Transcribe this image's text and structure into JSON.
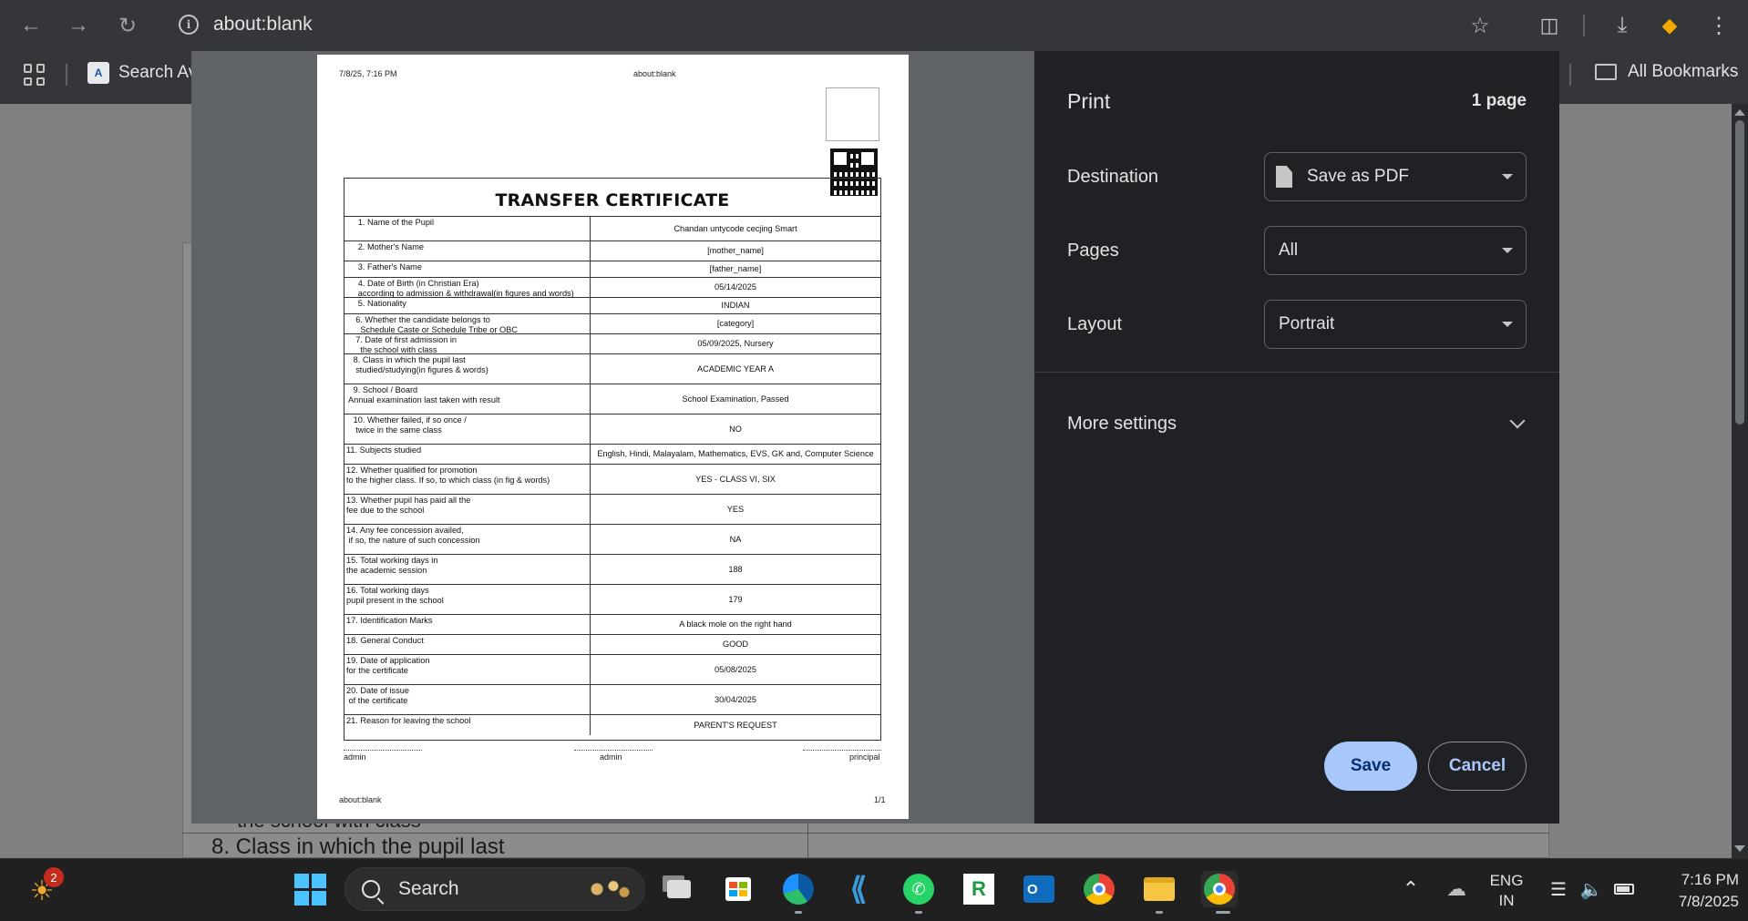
{
  "browser": {
    "url": "about:blank",
    "bookmarks": [
      {
        "label": "Search Ava"
      },
      {
        "label": "All Bookmarks"
      }
    ]
  },
  "preview": {
    "header_datetime": "7/8/25, 7:16 PM",
    "header_title": "about:blank",
    "certificate_title": "TRANSFER CERTIFICATE",
    "rows": [
      {
        "label": "     1. Name of the Pupil",
        "value": "Chandan untycode cecjing Smart",
        "h": 27
      },
      {
        "label": "     2. Mother's Name",
        "value": "[mother_name]",
        "h": 22
      },
      {
        "label": "     3. Father's Name",
        "value": "[father_name]",
        "h": 18
      },
      {
        "label": "     4. Date of Birth (in Christian Era)\n     according to admission & withdrawal(in figures and words)",
        "value": "05/14/2025",
        "h": 22
      },
      {
        "label": "     5. Nationality",
        "value": "INDIAN",
        "h": 18
      },
      {
        "label": "    6. Whether the candidate belongs to\n      Schedule Caste or Schedule Tribe or OBC",
        "value": "[category]",
        "h": 22
      },
      {
        "label": "    7. Date of first admission in\n      the school with class",
        "value": "05/09/2025, Nursery",
        "h": 22
      },
      {
        "label": "   8. Class in which the pupil last\n    studied/studying(in figures & words)",
        "value": "ACADEMIC YEAR  A",
        "h": 33
      },
      {
        "label": "   9. School / Board\n Annual examination last taken with result",
        "value": "School Examination, Passed",
        "h": 33
      },
      {
        "label": "   10. Whether failed, if so once /\n    twice in the same class",
        "value": "NO",
        "h": 33
      },
      {
        "label": "11. Subjects studied",
        "value": "English, Hindi, Malayalam, Mathematics, EVS, GK and, Computer Science",
        "h": 22
      },
      {
        "label": "12. Whether qualified for promotion\nto the higher class. If so, to which class (in fig & words)",
        "value": "YES - CLASS VI, SIX",
        "h": 33
      },
      {
        "label": "13. Whether pupil has paid all the\nfee due to the school",
        "value": "YES",
        "h": 33
      },
      {
        "label": "14. Any fee concession availed,\n if so, the nature of such concession",
        "value": "NA",
        "h": 33
      },
      {
        "label": "15. Total working days in\nthe academic session",
        "value": "188",
        "h": 33
      },
      {
        "label": "16. Total working days\npupil present in the school",
        "value": "179",
        "h": 33
      },
      {
        "label": "17. Identification Marks",
        "value": "A black mole on the right hand",
        "h": 22
      },
      {
        "label": "18. General Conduct",
        "value": "GOOD",
        "h": 22
      },
      {
        "label": "19. Date of application\nfor the certificate",
        "value": "05/08/2025",
        "h": 33
      },
      {
        "label": "20. Date of issue\n of the certificate",
        "value": "30/04/2025",
        "h": 33
      },
      {
        "label": "21. Reason for leaving the school",
        "value": "PARENT'S REQUEST",
        "h": 22
      }
    ],
    "signatures": [
      "admin",
      "admin",
      "principal"
    ],
    "footer_left": "about:blank",
    "footer_right": "1/1"
  },
  "print_panel": {
    "title": "Print",
    "page_count": "1 page",
    "destination_label": "Destination",
    "destination_value": "Save as PDF",
    "pages_label": "Pages",
    "pages_value": "All",
    "layout_label": "Layout",
    "layout_value": "Portrait",
    "more_settings": "More settings",
    "save": "Save",
    "cancel": "Cancel"
  },
  "background_page": {
    "line1": "the school with class",
    "line2": "8. Class in which the pupil last"
  },
  "taskbar": {
    "notification_count": "2",
    "search_text": "Search",
    "lang_line1": "ENG",
    "lang_line2": "IN",
    "time": "7:16 PM",
    "date": "7/8/2025"
  }
}
